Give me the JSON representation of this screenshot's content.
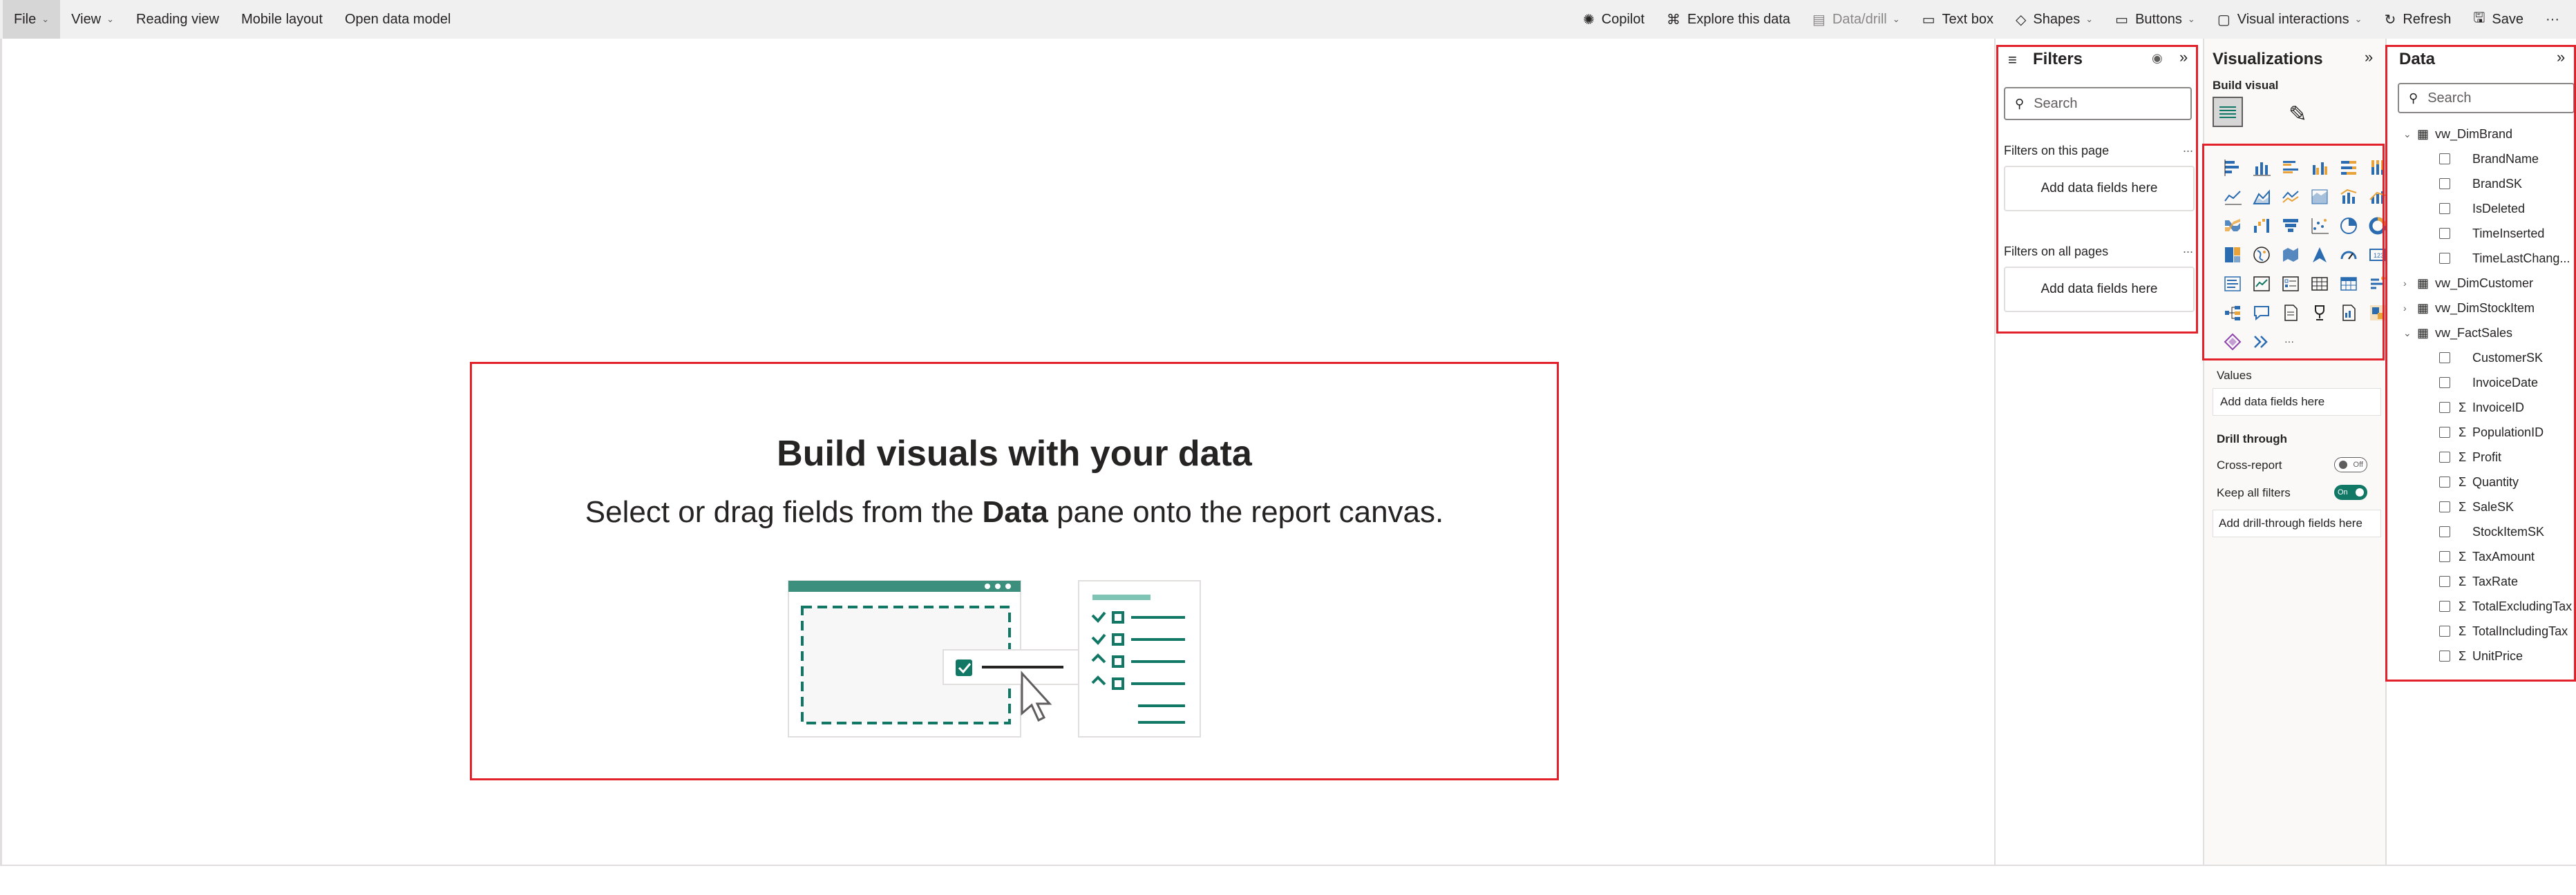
{
  "toolbar": {
    "left": [
      {
        "label": "File",
        "chevron": true,
        "active": true
      },
      {
        "label": "View",
        "chevron": true
      },
      {
        "label": "Reading view"
      },
      {
        "label": "Mobile layout"
      },
      {
        "label": "Open data model"
      }
    ],
    "right": [
      {
        "label": "Copilot",
        "icon": "copilot-icon",
        "glyph": "✺"
      },
      {
        "label": "Explore this data",
        "icon": "binoculars-icon",
        "glyph": "⌘"
      },
      {
        "label": "Data/drill",
        "icon": "data-drill-icon",
        "glyph": "▤",
        "chevron": true,
        "disabled": true
      },
      {
        "label": "Text box",
        "icon": "text-box-icon",
        "glyph": "▭"
      },
      {
        "label": "Shapes",
        "icon": "shapes-icon",
        "glyph": "◇",
        "chevron": true
      },
      {
        "label": "Buttons",
        "icon": "buttons-icon",
        "glyph": "▭",
        "chevron": true
      },
      {
        "label": "Visual interactions",
        "icon": "visual-interactions-icon",
        "glyph": "▢",
        "chevron": true
      },
      {
        "label": "Refresh",
        "icon": "refresh-icon",
        "glyph": "↻"
      },
      {
        "label": "Save",
        "icon": "save-icon",
        "glyph": "🖫"
      },
      {
        "label": "···",
        "icon": "more-icon"
      }
    ]
  },
  "canvas": {
    "title": "Build visuals with your data",
    "subtitle_pre": "Select or drag fields from the ",
    "subtitle_bold": "Data",
    "subtitle_post": " pane onto the report canvas."
  },
  "filters": {
    "title": "Filters",
    "search_placeholder": "Search",
    "on_this_page": "Filters on this page",
    "on_all_pages": "Filters on all pages",
    "add_fields": "Add data fields here",
    "more": "..."
  },
  "visualizations": {
    "title": "Visualizations",
    "build_visual": "Build visual",
    "values_label": "Values",
    "values_add": "Add data fields here",
    "drill_through": "Drill through",
    "cross_report": "Cross-report",
    "cross_report_state": "Off",
    "keep_all_filters": "Keep all filters",
    "keep_all_filters_state": "On",
    "drill_add": "Add drill-through fields here",
    "more_visuals": "···"
  },
  "data_pane": {
    "title": "Data",
    "search_placeholder": "Search",
    "tables": [
      {
        "name": "vw_DimBrand",
        "expanded": true,
        "fields": [
          {
            "name": "BrandName",
            "sigma": false
          },
          {
            "name": "BrandSK",
            "sigma": false
          },
          {
            "name": "IsDeleted",
            "sigma": false
          },
          {
            "name": "TimeInserted",
            "sigma": false
          },
          {
            "name": "TimeLastChang...",
            "sigma": false
          }
        ]
      },
      {
        "name": "vw_DimCustomer",
        "expanded": false,
        "fields": []
      },
      {
        "name": "vw_DimStockItem",
        "expanded": false,
        "fields": []
      },
      {
        "name": "vw_FactSales",
        "expanded": true,
        "fields": [
          {
            "name": "CustomerSK",
            "sigma": false
          },
          {
            "name": "InvoiceDate",
            "sigma": false
          },
          {
            "name": "InvoiceID",
            "sigma": true
          },
          {
            "name": "PopulationID",
            "sigma": true
          },
          {
            "name": "Profit",
            "sigma": true
          },
          {
            "name": "Quantity",
            "sigma": true
          },
          {
            "name": "SaleSK",
            "sigma": true
          },
          {
            "name": "StockItemSK",
            "sigma": false
          },
          {
            "name": "TaxAmount",
            "sigma": true
          },
          {
            "name": "TaxRate",
            "sigma": true
          },
          {
            "name": "TotalExcludingTax",
            "sigma": true
          },
          {
            "name": "TotalIncludingTax",
            "sigma": true
          },
          {
            "name": "UnitPrice",
            "sigma": true
          }
        ]
      }
    ]
  },
  "colors": {
    "accent_red": "#e3212b",
    "teal": "#117865",
    "viz_blue": "#2b6cb0",
    "viz_orange": "#e8a33b"
  }
}
